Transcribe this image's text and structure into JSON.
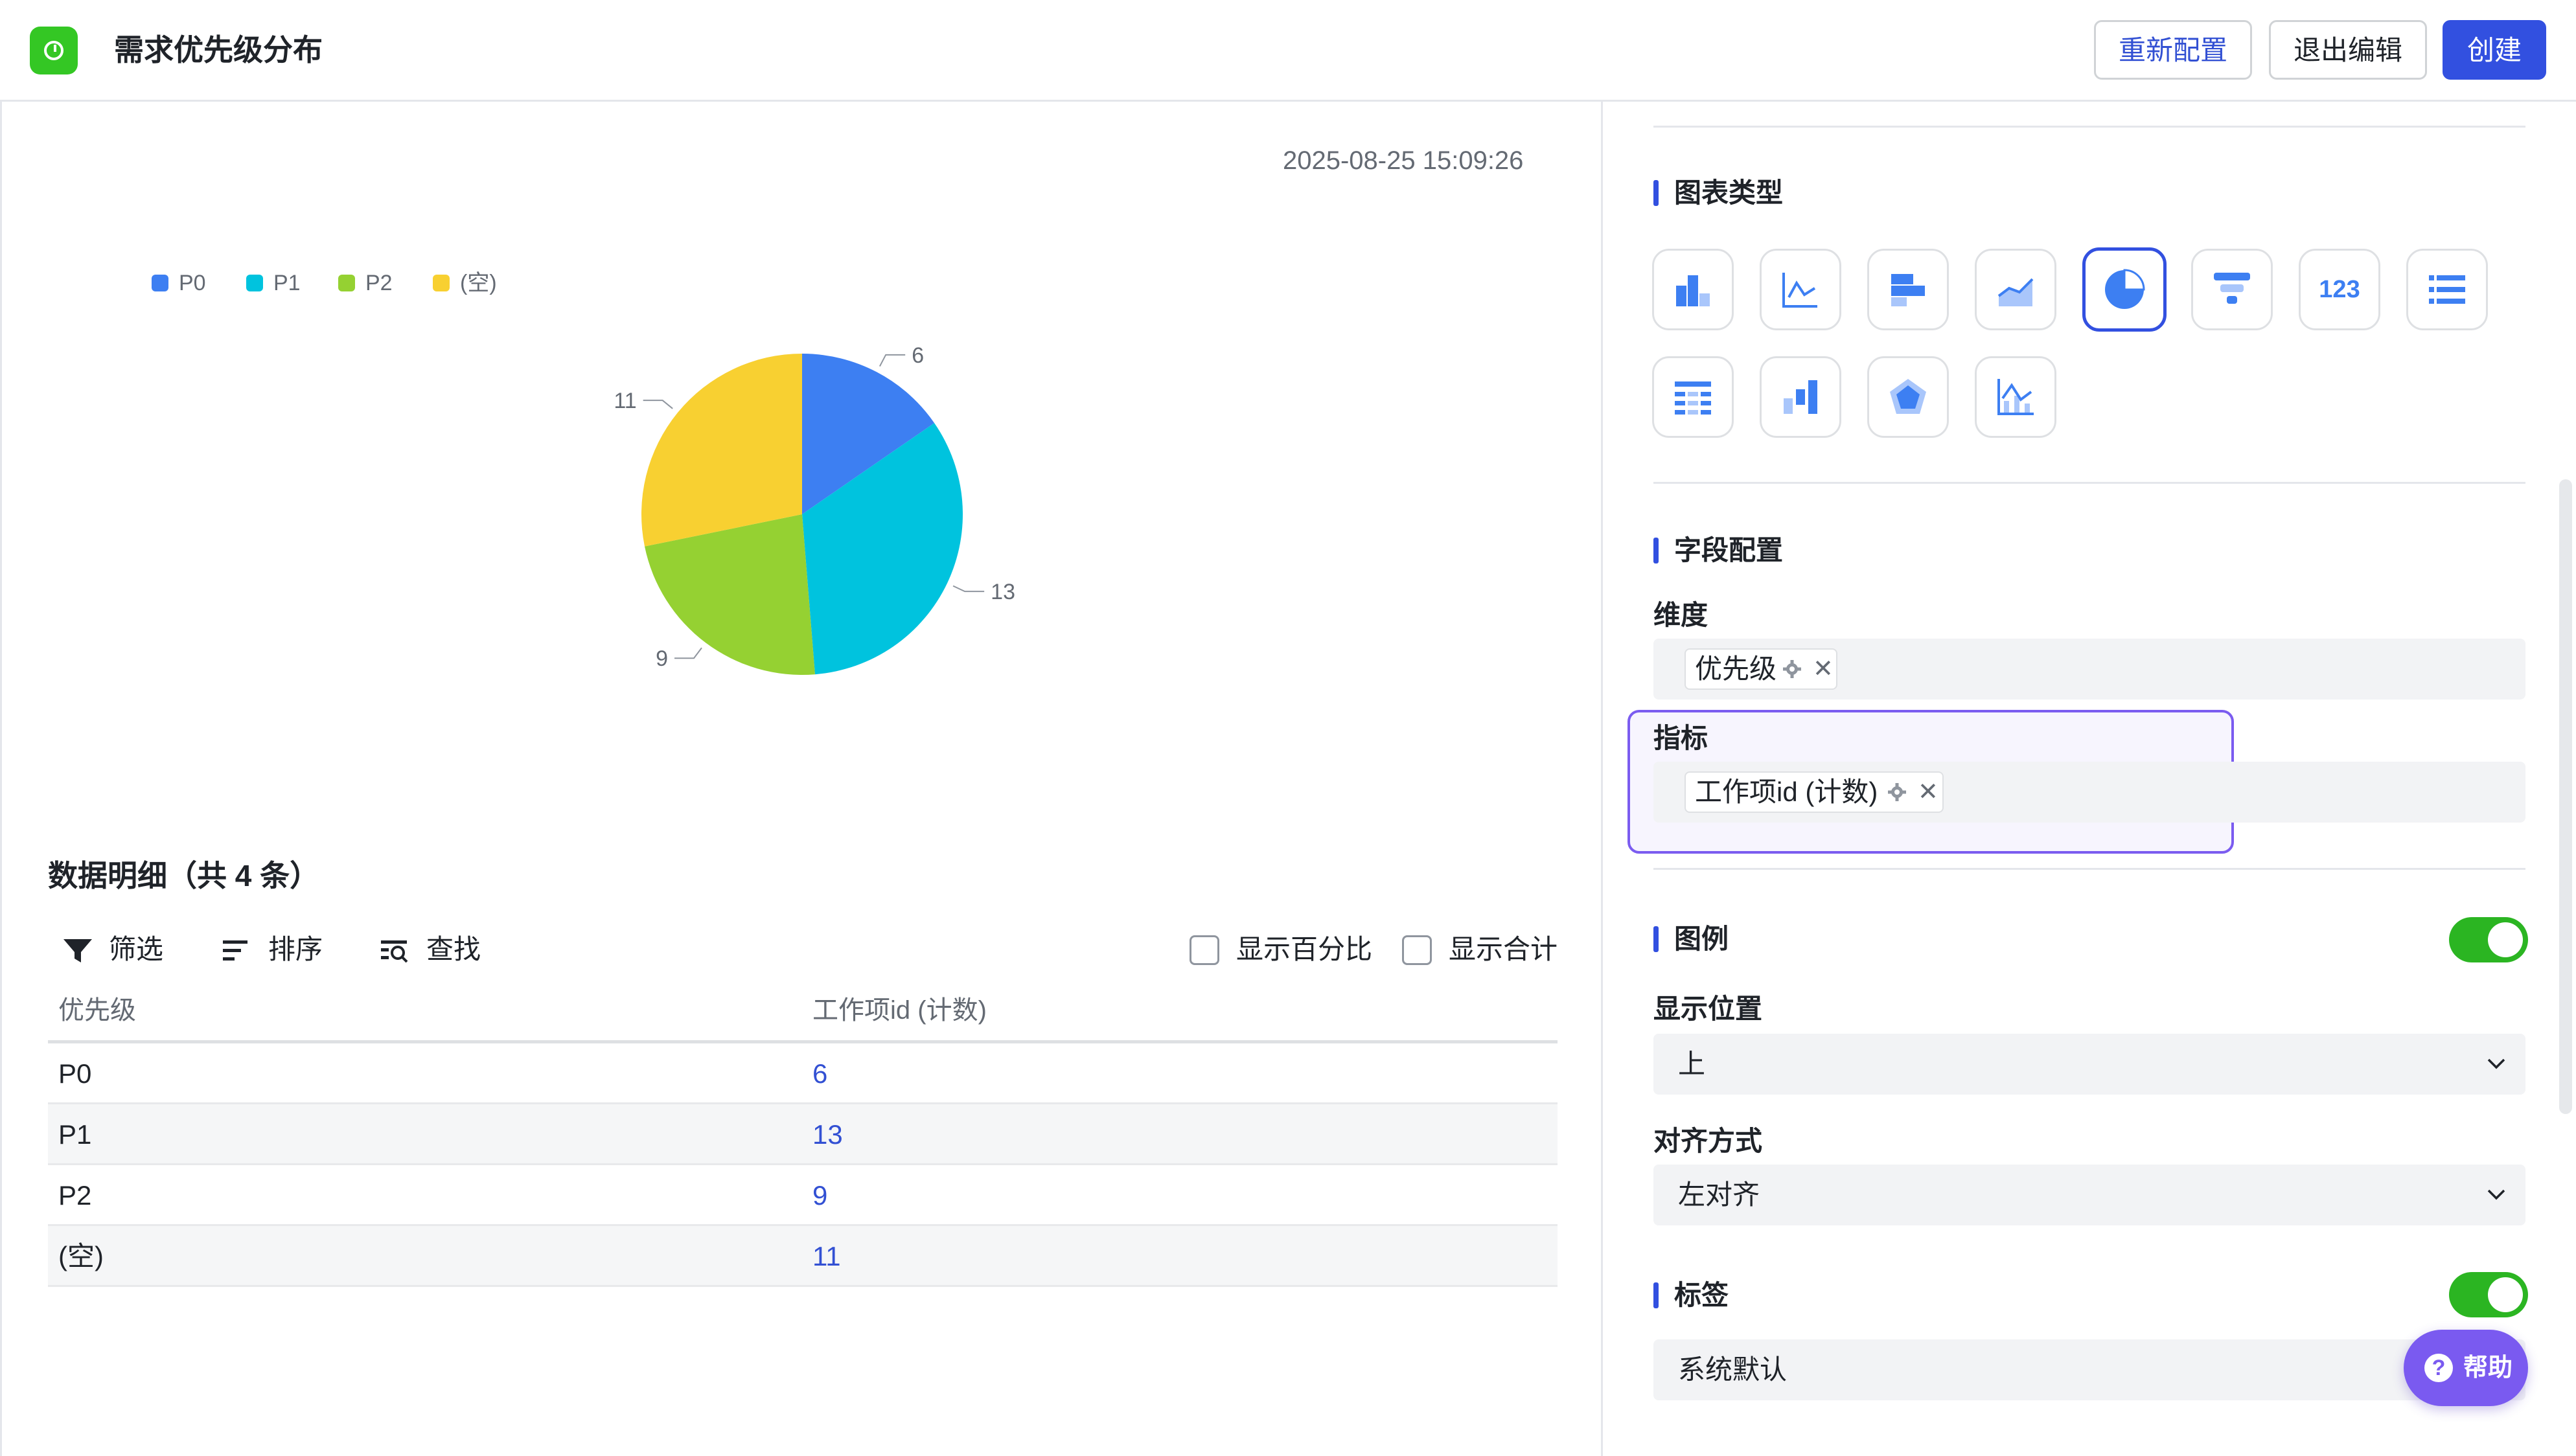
{
  "header": {
    "title": "需求优先级分布",
    "buttons": {
      "reconfigure": "重新配置",
      "exit_edit": "退出编辑",
      "create": "创建"
    }
  },
  "chart": {
    "timestamp": "2025-08-25 15:09:26",
    "legend": [
      "P0",
      "P1",
      "P2",
      "(空)"
    ],
    "colors": {
      "P0": "#3d7ff2",
      "P1": "#00c3de",
      "P2": "#95d132",
      "(空)": "#f8d031"
    }
  },
  "chart_data": {
    "type": "pie",
    "categories": [
      "P0",
      "P1",
      "P2",
      "(空)"
    ],
    "values": [
      6,
      13,
      9,
      11
    ],
    "legend_position": "top-left"
  },
  "details": {
    "title": "数据明细（共 4 条）",
    "toolbar": {
      "filter": "筛选",
      "sort": "排序",
      "find": "查找",
      "show_percent": "显示百分比",
      "show_total": "显示合计"
    },
    "columns": [
      "优先级",
      "工作项id (计数)"
    ],
    "rows": [
      [
        "P0",
        "6"
      ],
      [
        "P1",
        "13"
      ],
      [
        "P2",
        "9"
      ],
      [
        "(空)",
        "11"
      ]
    ]
  },
  "config": {
    "chart_type_title": "图表类型",
    "chart_type_icons": [
      "bar-chart-icon",
      "line-chart-icon",
      "horizontal-bar-icon",
      "area-chart-icon",
      "pie-chart-icon",
      "funnel-icon",
      "number-card-icon",
      "list-icon",
      "table-icon",
      "waterfall-icon",
      "radar-icon",
      "combo-chart-icon"
    ],
    "selected_chart_type": "pie-chart-icon",
    "number_card_text": "123",
    "field_title": "字段配置",
    "dimension_label": "维度",
    "dimension_tag": "优先级",
    "metric_label": "指标",
    "metric_tag": "工作项id (计数)",
    "legend_title": "图例",
    "legend_enabled": true,
    "position_label": "显示位置",
    "position_value": "上",
    "align_label": "对齐方式",
    "align_value": "左对齐",
    "label_title": "标签",
    "label_enabled": true,
    "label_value": "系统默认"
  },
  "help": {
    "label": "帮助",
    "icon": "?"
  }
}
